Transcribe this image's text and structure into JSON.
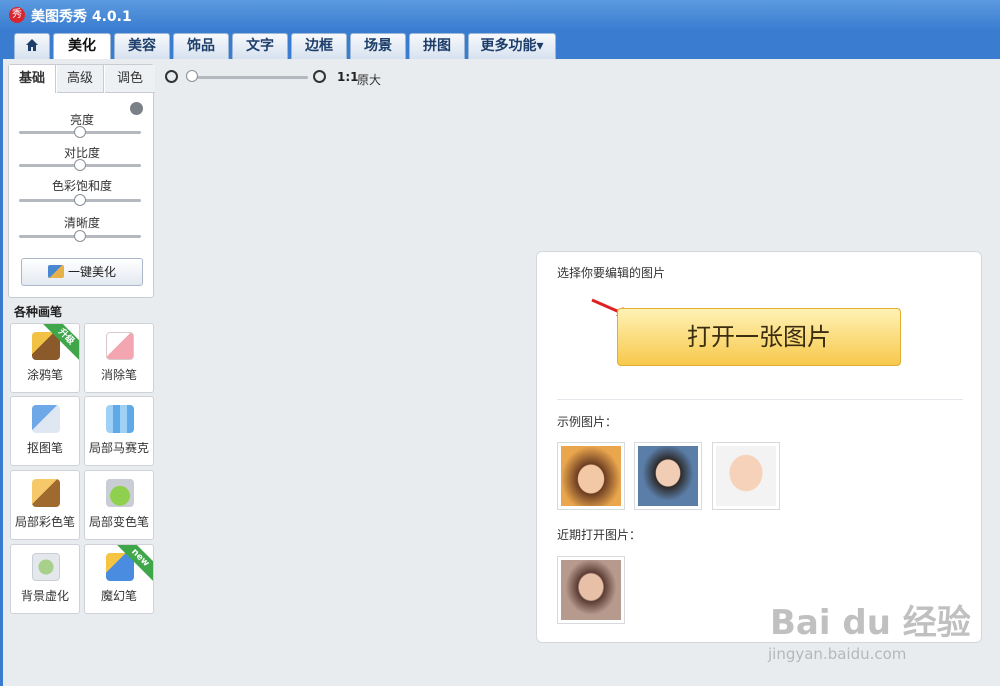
{
  "window": {
    "logo_glyph": "秀",
    "title": "美图秀秀 4.0.1"
  },
  "tabs": [
    {
      "label": "",
      "icon": "home-icon"
    },
    {
      "label": "美化",
      "active": true
    },
    {
      "label": "美容"
    },
    {
      "label": "饰品"
    },
    {
      "label": "文字"
    },
    {
      "label": "边框"
    },
    {
      "label": "场景"
    },
    {
      "label": "拼图"
    },
    {
      "label": "更多功能▾"
    }
  ],
  "adjust": {
    "subtabs": [
      "基础",
      "高级",
      "调色"
    ],
    "active_subtab": "基础",
    "reset_icon": "reset-icon",
    "sliders": [
      {
        "label": "亮度",
        "value": 0.5
      },
      {
        "label": "对比度",
        "value": 0.5
      },
      {
        "label": "色彩饱和度",
        "value": 0.5
      },
      {
        "label": "清晰度",
        "value": 0.5
      }
    ],
    "oneclick_label": "一键美化"
  },
  "brushes": {
    "title": "各种画笔",
    "items": [
      {
        "label": "涂鸦笔",
        "badge": "升级",
        "icon": "paintbrush-icon"
      },
      {
        "label": "消除笔",
        "badge": "",
        "icon": "eraser-icon"
      },
      {
        "label": "抠图笔",
        "badge": "",
        "icon": "cutout-pen-icon"
      },
      {
        "label": "局部马赛克",
        "badge": "",
        "icon": "mosaic-icon"
      },
      {
        "label": "局部彩色笔",
        "badge": "",
        "icon": "color-brush-icon"
      },
      {
        "label": "局部变色笔",
        "badge": "",
        "icon": "paint-bucket-icon"
      },
      {
        "label": "背景虚化",
        "badge": "",
        "icon": "blur-icon"
      },
      {
        "label": "魔幻笔",
        "badge": "new",
        "icon": "magic-pen-icon"
      }
    ]
  },
  "zoom": {
    "ratio_label": "1:1",
    "original_label": "原大",
    "level": 0.0
  },
  "open_card": {
    "prompt": "选择你要编辑的图片",
    "open_button": "打开一张图片",
    "samples_label": "示例图片：",
    "recent_label": "近期打开图片："
  },
  "watermark": {
    "main": "Bai du 经验",
    "sub": "jingyan.baidu.com"
  },
  "colors": {
    "accent": "#3a7dd0",
    "open_button": "#f7c84b",
    "ribbon_upgrade": "#3fa64a"
  }
}
